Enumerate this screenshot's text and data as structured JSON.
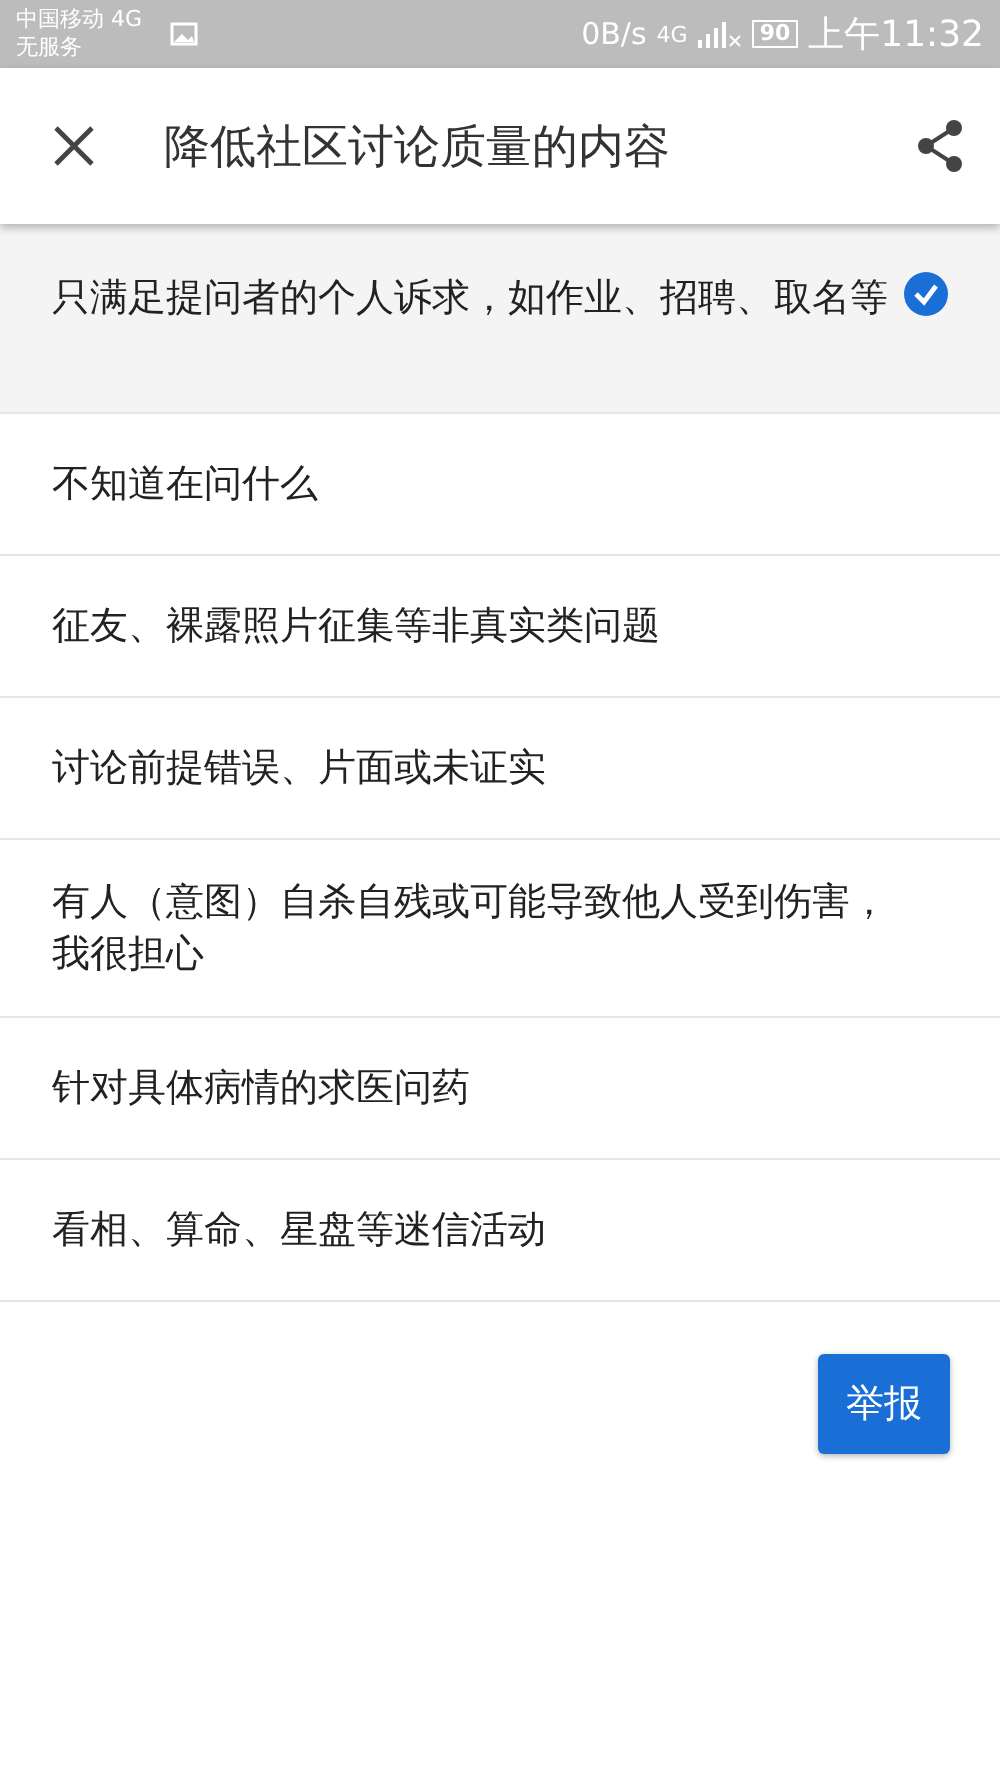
{
  "status_bar": {
    "carrier": "中国移动 4G",
    "service": "无服务",
    "speed": "0B/s",
    "network": "4G",
    "battery": "90",
    "time": "上午11:32"
  },
  "toolbar": {
    "title": "降低社区讨论质量的内容"
  },
  "options": [
    {
      "label": "只满足提问者的个人诉求，如作业、招聘、取名等",
      "selected": true
    },
    {
      "label": "不知道在问什么",
      "selected": false
    },
    {
      "label": "征友、裸露照片征集等非真实类问题",
      "selected": false
    },
    {
      "label": "讨论前提错误、片面或未证实",
      "selected": false
    },
    {
      "label": "有人（意图）自杀自残或可能导致他人受到伤害，我很担心",
      "selected": false
    },
    {
      "label": "针对具体病情的求医问药",
      "selected": false
    },
    {
      "label": "看相、算命、星盘等迷信活动",
      "selected": false
    }
  ],
  "submit_button": "举报"
}
